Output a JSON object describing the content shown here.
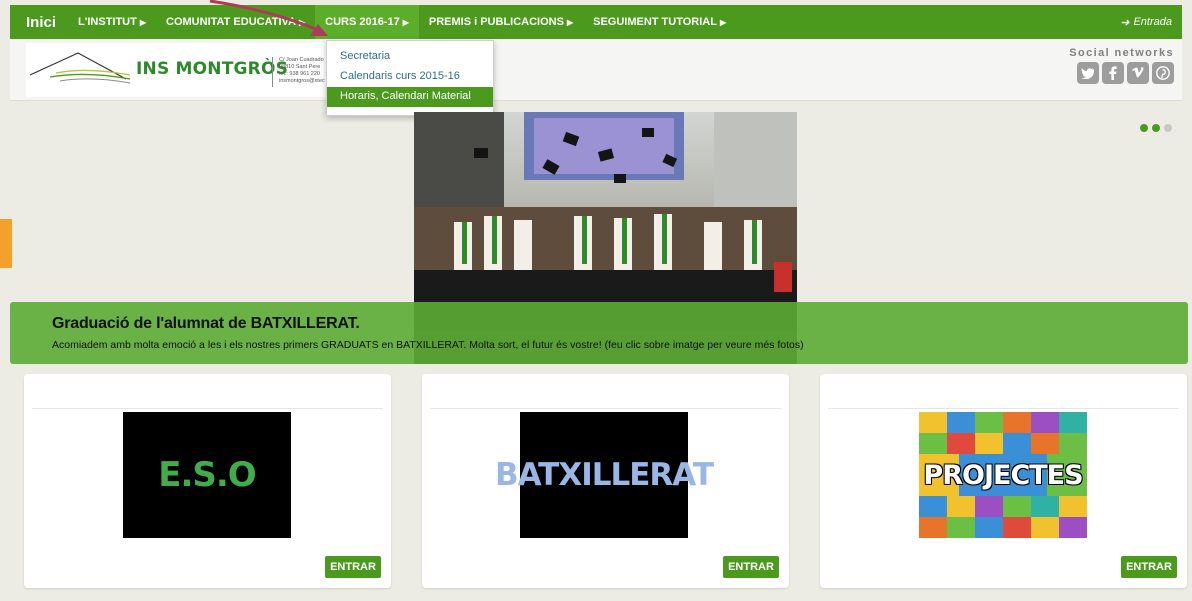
{
  "nav": {
    "brand": "Inici",
    "items": [
      {
        "label": "L'INSTITUT"
      },
      {
        "label": "COMUNITAT EDUCATIVA"
      },
      {
        "label": "CURS 2016-17"
      },
      {
        "label": "PREMIS i PUBLICACIONS"
      },
      {
        "label": "SEGUIMENT TUTORIAL"
      }
    ],
    "login_label": "Entrada"
  },
  "dropdown": {
    "items": [
      {
        "label": "Secretaria"
      },
      {
        "label": "Calendaris curs 2015-16"
      },
      {
        "label": "Horaris, Calendari Material"
      }
    ]
  },
  "header": {
    "school_name": "INS MONTGRÒS",
    "address_lines": [
      "C/ Joan Cuadrado",
      "08810 Sant Pere",
      "tel.: 938 961 220",
      "insmontgros@xtec"
    ],
    "social_label": "Social networks",
    "social_icons": [
      "twitter-icon",
      "facebook-icon",
      "vimeo-icon",
      "pinterest-icon"
    ]
  },
  "slider": {
    "title": "Graduació de l'alumnat de BATXILLERAT.",
    "text": "Acomiadem amb molta emoció a les i els nostres primers GRADUATS en BATXILLERAT. Molta sort, el futur és vostre! (feu clic sobre imatge per veure més fotos)",
    "dots": 3,
    "active_dot": 2
  },
  "cards": [
    {
      "image_text": "E.S.O",
      "button": "ENTRAR"
    },
    {
      "image_text": "BATXILLERAT",
      "button": "ENTRAR"
    },
    {
      "image_text": "PROJECTES",
      "button": "ENTRAR"
    }
  ],
  "colors": {
    "brand_green": "#4b9a1e",
    "accent_orange": "#f3a12a",
    "link_blue": "#2e6e8a"
  }
}
